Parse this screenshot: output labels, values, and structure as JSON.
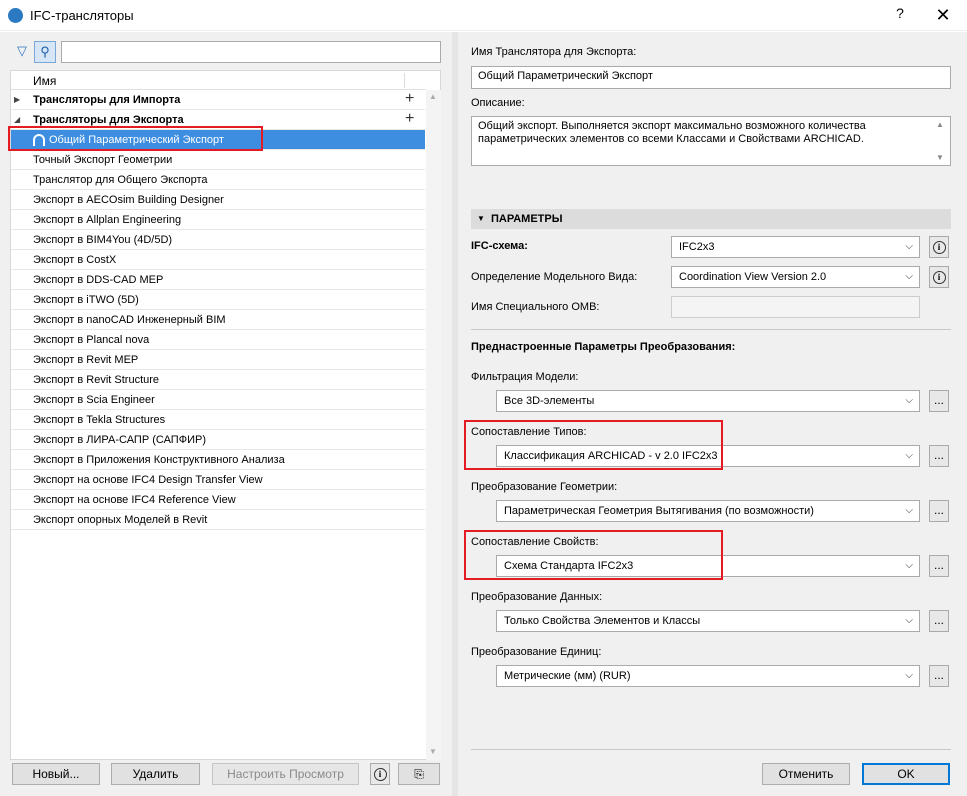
{
  "window": {
    "title": "IFC-трансляторы",
    "help": "?",
    "close": "✕"
  },
  "left": {
    "search_value": "",
    "column_header": "Имя",
    "groups": [
      {
        "label": "Трансляторы для Импорта",
        "expanded": false
      },
      {
        "label": "Трансляторы для Экспорта",
        "expanded": true
      }
    ],
    "selected_item": "Общий Параметрический Экспорт",
    "items": [
      "Точный Экспорт Геометрии",
      "Транслятор для Общего Экспорта",
      "Экспорт в AECOsim Building Designer",
      "Экспорт в Allplan Engineering",
      "Экспорт в BIM4You (4D/5D)",
      "Экспорт в CostX",
      "Экспорт в DDS-CAD MEP",
      "Экспорт в iTWO (5D)",
      "Экспорт в nanoCAD Инженерный BIM",
      "Экспорт в Plancal nova",
      "Экспорт в Revit MEP",
      "Экспорт в Revit Structure",
      "Экспорт в Scia Engineer",
      "Экспорт в Tekla Structures",
      "Экспорт в ЛИРА-САПР (САПФИР)",
      "Экспорт в Приложения Конструктивного Анализа",
      "Экспорт на основе IFC4 Design Transfer View",
      "Экспорт на основе IFC4 Reference View",
      "Экспорт опорных Моделей в Revit"
    ],
    "buttons": {
      "new": "Новый...",
      "delete": "Удалить",
      "configure": "Настроить Просмотр"
    }
  },
  "right": {
    "name_label": "Имя Транслятора для Экспорта:",
    "name_value": "Общий Параметрический Экспорт",
    "desc_label": "Описание:",
    "desc_value": "Общий экспорт. Выполняется экспорт максимально возможного количества параметрических элементов со всеми Классами и Свойствами ARCHICAD.",
    "section_title": "ПАРАМЕТРЫ",
    "ifc_schema_label": "IFC-схема:",
    "ifc_schema_value": "IFC2x3",
    "mvd_label": "Определение Модельного Вида:",
    "mvd_value": "Coordination View Version 2.0",
    "custom_mvd_label": "Имя Специального ОМВ:",
    "custom_mvd_value": "",
    "preset_header": "Преднастроенные Параметры Преобразования:",
    "model_filter_label": "Фильтрация Модели:",
    "model_filter_value": "Все 3D-элементы",
    "type_mapping_label": "Сопоставление Типов:",
    "type_mapping_value": "Классификация ARCHICAD - v 2.0 IFC2x3",
    "geometry_label": "Преобразование Геометрии:",
    "geometry_value": "Параметрическая Геометрия Вытягивания (по возможности)",
    "property_mapping_label": "Сопоставление Свойств:",
    "property_mapping_value": "Схема Стандарта IFC2x3",
    "data_label": "Преобразование Данных:",
    "data_value": "Только Свойства Элементов и Классы",
    "units_label": "Преобразование Единиц:",
    "units_value": "Метрические (мм) (RUR)",
    "dots": "...",
    "cancel": "Отменить",
    "ok": "OK"
  },
  "colors": {
    "selection": "#3d8ee0",
    "highlight_box": "#e51b23",
    "accent": "#2b79c2"
  }
}
